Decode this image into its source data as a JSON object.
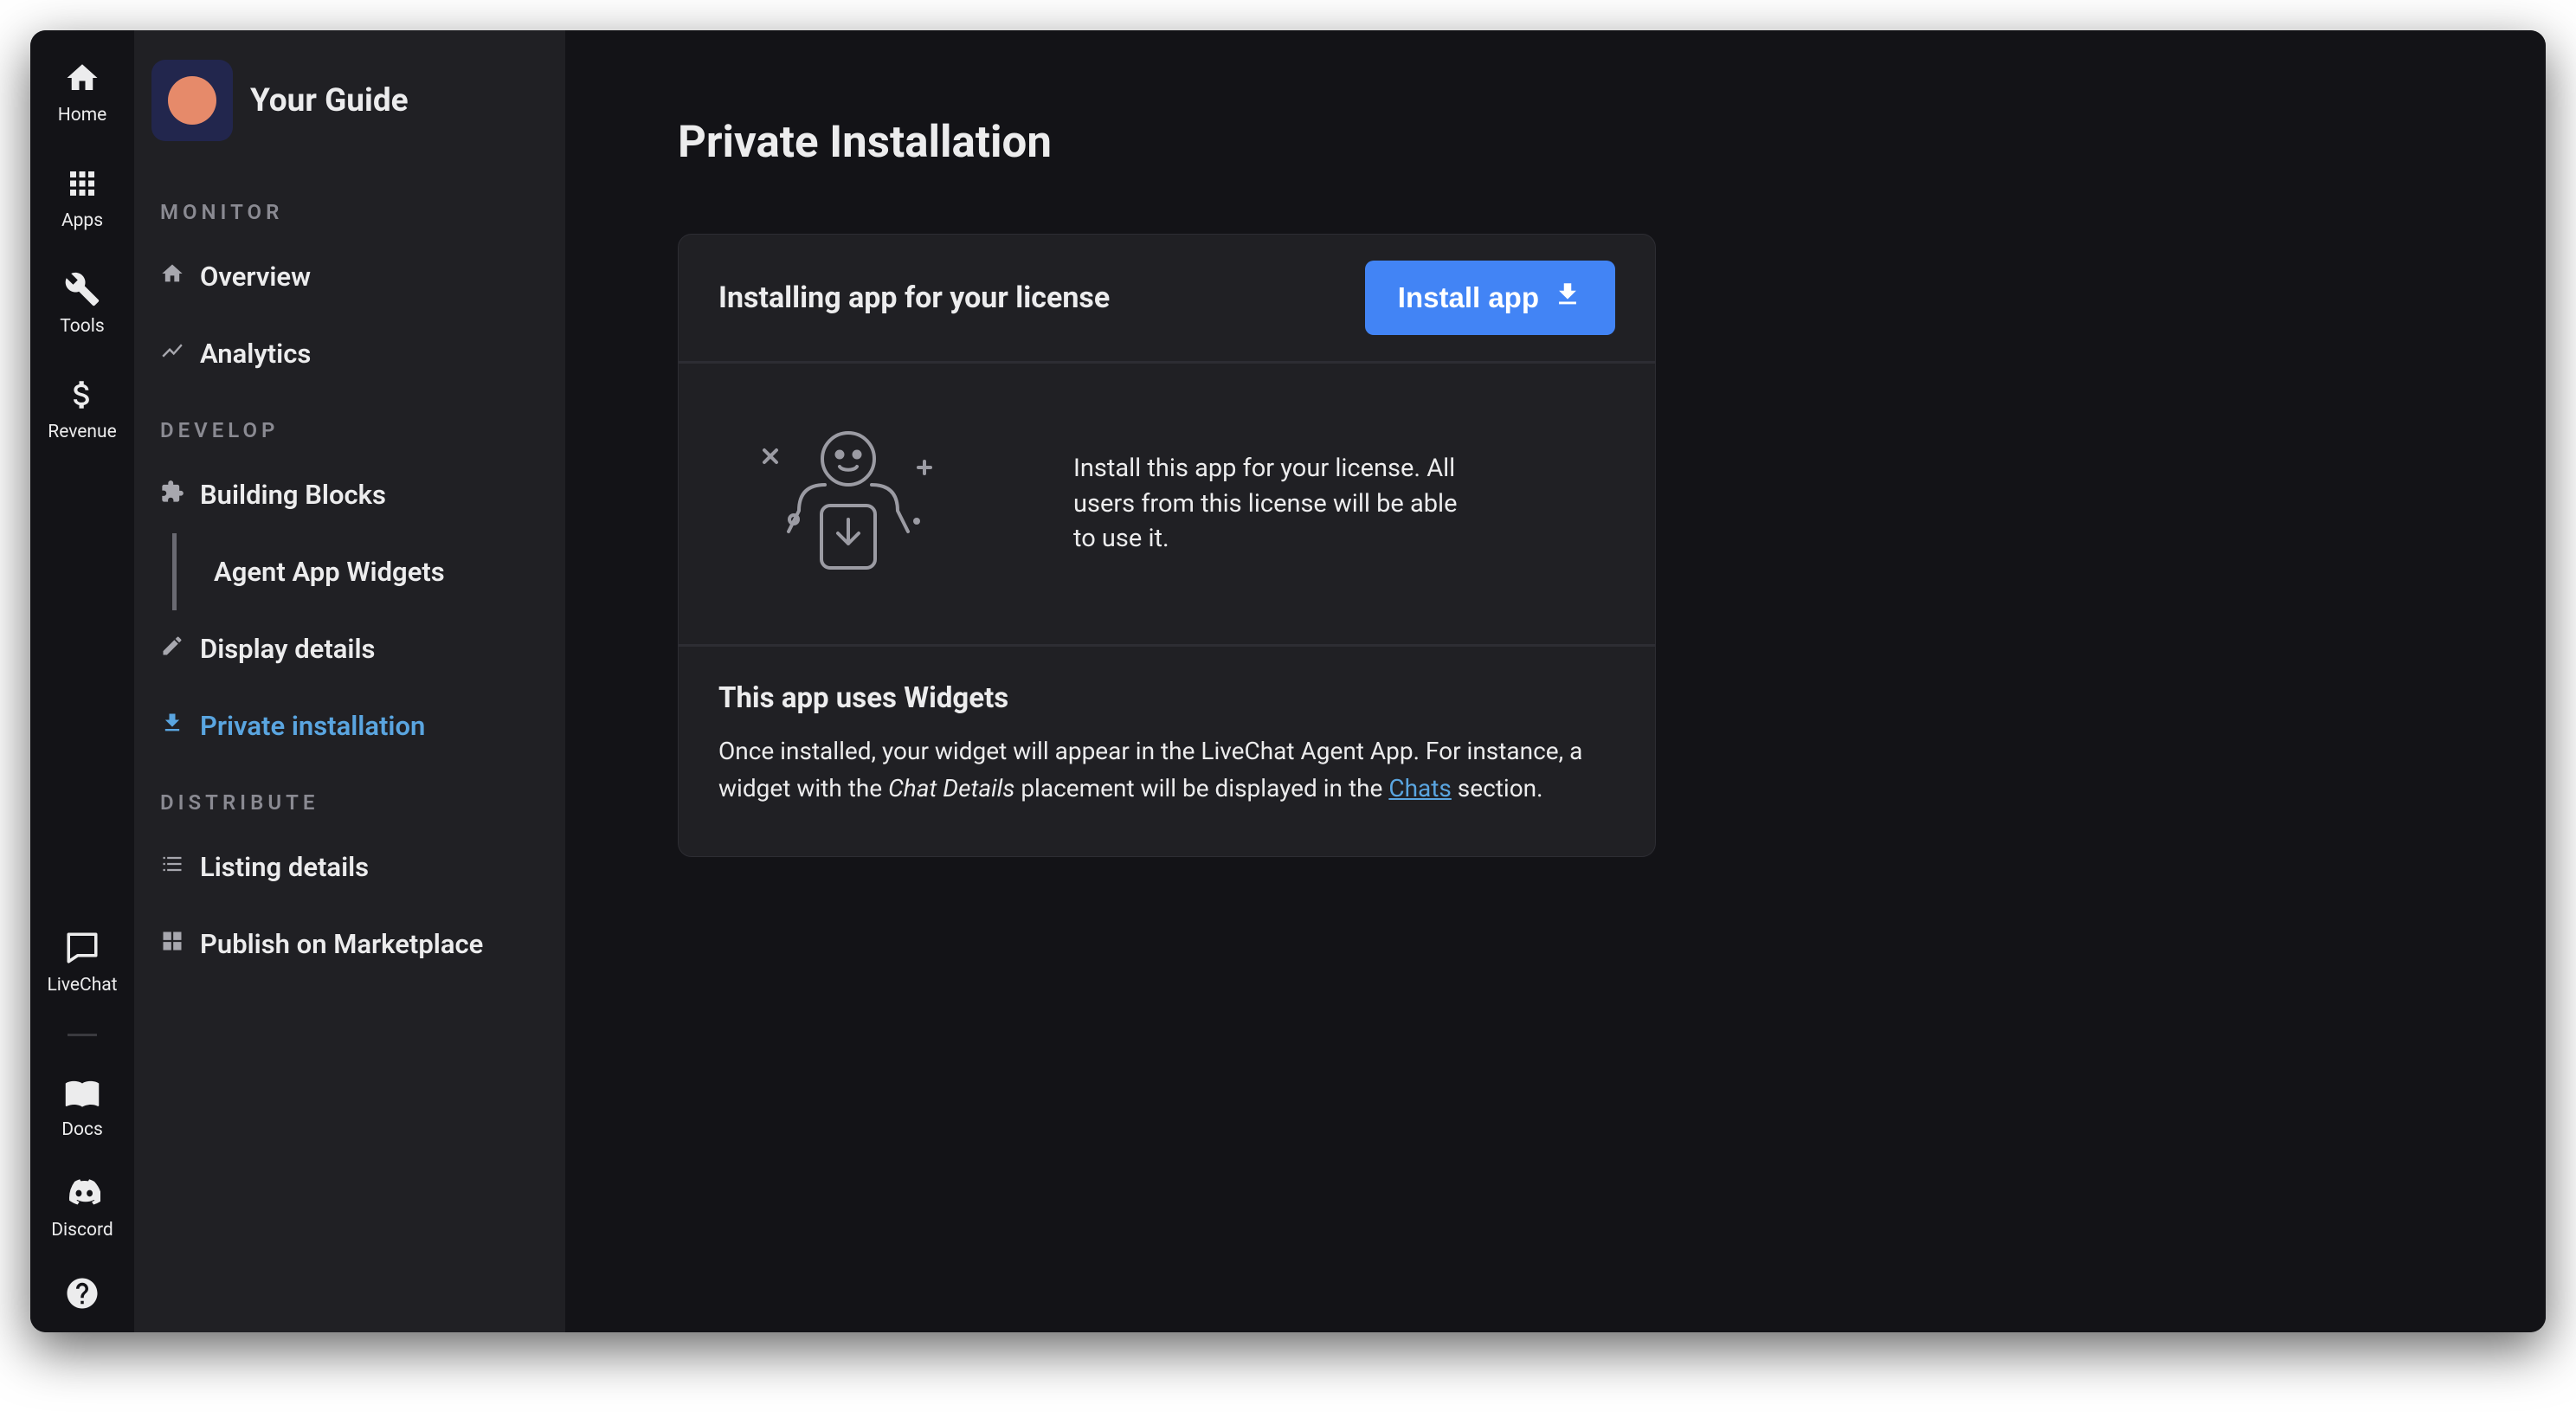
{
  "rail": {
    "top": {
      "home": "Home",
      "apps": "Apps",
      "tools": "Tools",
      "revenue": "Revenue"
    },
    "bottom": {
      "livechat": "LiveChat",
      "docs": "Docs",
      "discord": "Discord"
    }
  },
  "sidebar": {
    "app_title": "Your Guide",
    "sections": {
      "monitor": "MONITOR",
      "develop": "DEVELOP",
      "distribute": "DISTRIBUTE"
    },
    "items": {
      "overview": "Overview",
      "analytics": "Analytics",
      "building_blocks": "Building Blocks",
      "agent_app_widgets": "Agent App Widgets",
      "display_details": "Display details",
      "private_installation": "Private installation",
      "listing_details": "Listing details",
      "publish_marketplace": "Publish on Marketplace"
    }
  },
  "main": {
    "page_title": "Private Installation",
    "panel1": {
      "header": "Installing app for your license",
      "button": "Install app",
      "body": "Install this app for your license. All users from this license will be able to use it."
    },
    "panel2": {
      "header": "This app uses Widgets",
      "p1a": "Once installed, your widget will appear in the LiveChat Agent App. For instance, a widget with the ",
      "em": "Chat Details",
      "p1b": " placement will be displayed in the ",
      "link": "Chats",
      "p1c": " section."
    }
  },
  "colors": {
    "accent": "#4284f5",
    "link": "#5aa5e0"
  }
}
